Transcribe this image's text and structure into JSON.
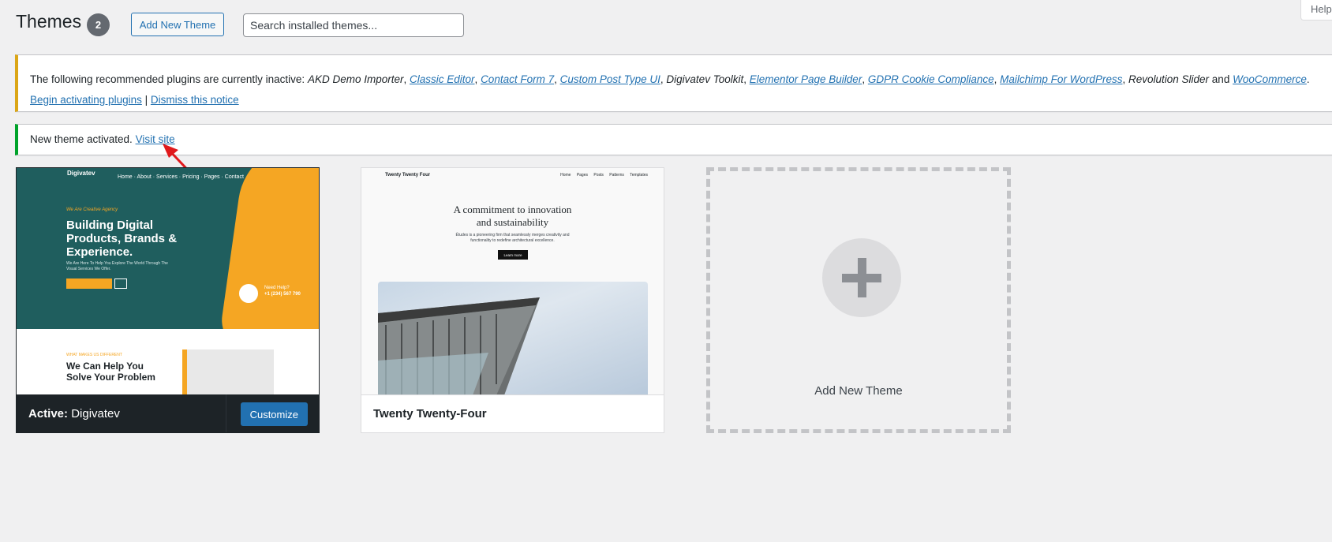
{
  "header": {
    "title": "Themes",
    "count": "2",
    "add_new_label": "Add New Theme",
    "search_placeholder": "Search installed themes...",
    "help_label": "Help"
  },
  "notice_plugins": {
    "prefix": "The following recommended plugins are currently inactive:",
    "plugins": [
      {
        "name": "AKD Demo Importer",
        "link": false
      },
      {
        "name": "Classic Editor",
        "link": true
      },
      {
        "name": "Contact Form 7",
        "link": true
      },
      {
        "name": "Custom Post Type UI",
        "link": true
      },
      {
        "name": "Digivatev Toolkit",
        "link": false
      },
      {
        "name": "Elementor Page Builder",
        "link": true
      },
      {
        "name": "GDPR Cookie Compliance",
        "link": true
      },
      {
        "name": "Mailchimp For WordPress",
        "link": true
      },
      {
        "name": "Revolution Slider",
        "link": false
      },
      {
        "name": "WooCommerce",
        "link": true
      }
    ],
    "and_word": "and",
    "begin_label": "Begin activating plugins",
    "separator": "|",
    "dismiss_label": "Dismiss this notice"
  },
  "notice_activated": {
    "text": "New theme activated.",
    "visit_label": "Visit site"
  },
  "themes": {
    "active": {
      "active_prefix": "Active:",
      "name": "Digivatev",
      "customize_label": "Customize",
      "preview": {
        "logo": "Digivatev",
        "nav": "Home · About · Services · Pricing · Pages · Contact",
        "tagline": "We Are Creative Agency",
        "headline": "Building Digital Products, Brands & Experience.",
        "body": "We Are Here To Help You Explore The World Through The Visual Services We Offer.",
        "phone_label": "Need Help?",
        "phone": "+1 (234) 567 790",
        "lower_tag": "WHAT MAKES US DIFFERENT",
        "lower_headline": "We Can Help You Solve Your Problem"
      }
    },
    "second": {
      "name": "Twenty Twenty-Four",
      "preview": {
        "brand": "Twenty Twenty Four",
        "menu": "Home Pages Posts Patterns Templates",
        "headline": "A commitment to innovation and sustainability",
        "body": "Études is a pioneering firm that seamlessly merges creativity and functionality to redefine architectural excellence.",
        "button": "Learn more"
      }
    },
    "add_new_label": "Add New Theme"
  },
  "colors": {
    "accent": "#2271b1",
    "warning": "#dba617",
    "success": "#00a32a",
    "annotation_arrow": "#e0191c"
  }
}
